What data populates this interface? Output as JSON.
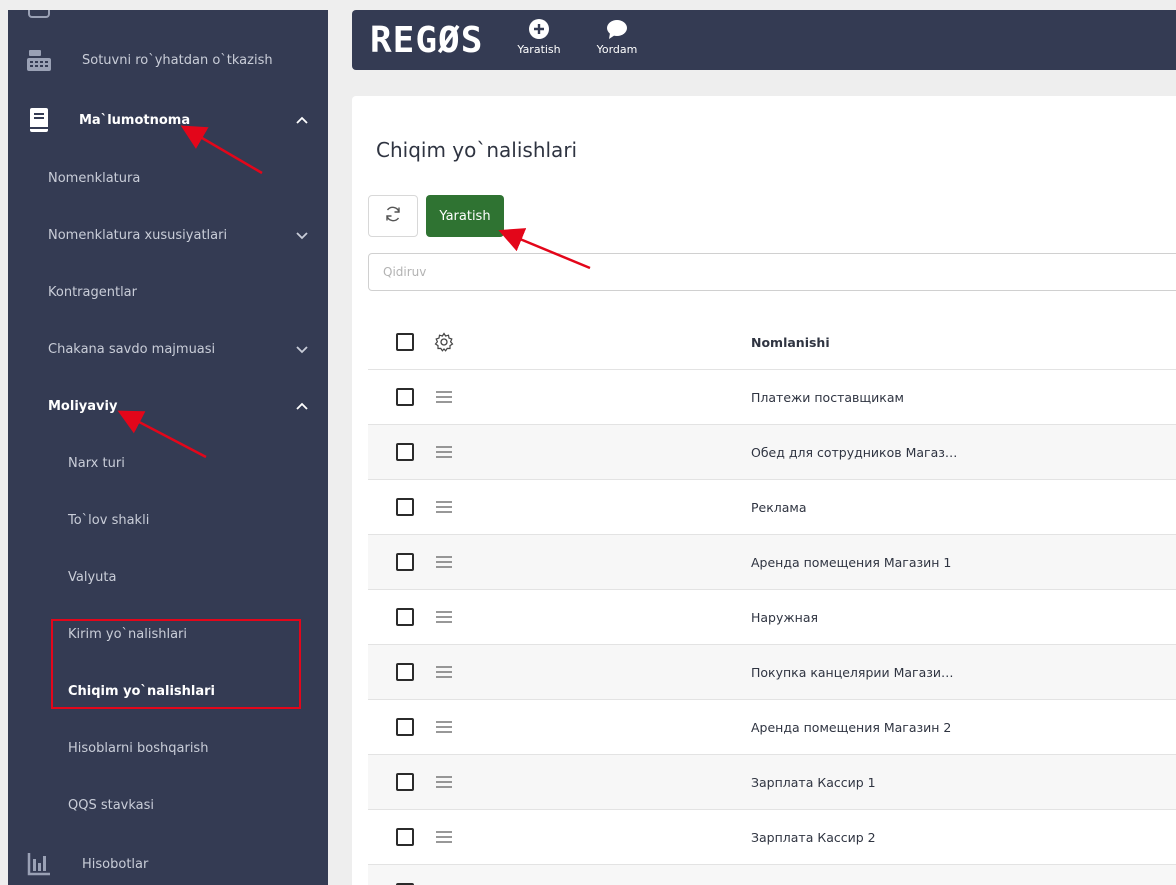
{
  "sidebar": {
    "items": [
      {
        "label": "Sotuvni ro`yhatdan o`tkazish",
        "icon": "cash-register-icon"
      },
      {
        "label": "Ma`lumotnoma",
        "icon": "book-icon"
      },
      {
        "label": "Nomenklatura"
      },
      {
        "label": "Nomenklatura xususiyatlari"
      },
      {
        "label": "Kontragentlar"
      },
      {
        "label": "Chakana savdo majmuasi"
      },
      {
        "label": "Moliyaviy"
      },
      {
        "label": "Narx turi"
      },
      {
        "label": "To`lov shakli"
      },
      {
        "label": "Valyuta"
      },
      {
        "label": "Kirim yo`nalishlari"
      },
      {
        "label": "Chiqim yo`nalishlari"
      },
      {
        "label": "Hisoblarni boshqarish"
      },
      {
        "label": "QQS stavkasi"
      },
      {
        "label": "Hisobotlar",
        "icon": "chart-icon"
      }
    ]
  },
  "header": {
    "logo": "REGØS",
    "create_label": "Yaratish",
    "help_label": "Yordam"
  },
  "main": {
    "title": "Chiqim yo`nalishlari",
    "create_button": "Yaratish",
    "search_placeholder": "Qidiruv",
    "table": {
      "column_name": "Nomlanishi",
      "rows": [
        "Платежи поставщикам",
        "Обед для сотрудников Магаз…",
        "Реклама",
        "Аренда помещения Магазин 1",
        "Наружная",
        "Покупка канцелярии Магази…",
        "Аренда помещения Магазин 2",
        "Зарплата Кассир 1",
        "Зарплата Кассир 2"
      ]
    }
  },
  "colors": {
    "sidebar_bg": "#343b53",
    "accent_green": "#2f7332",
    "annotation_red": "#e3061a"
  }
}
